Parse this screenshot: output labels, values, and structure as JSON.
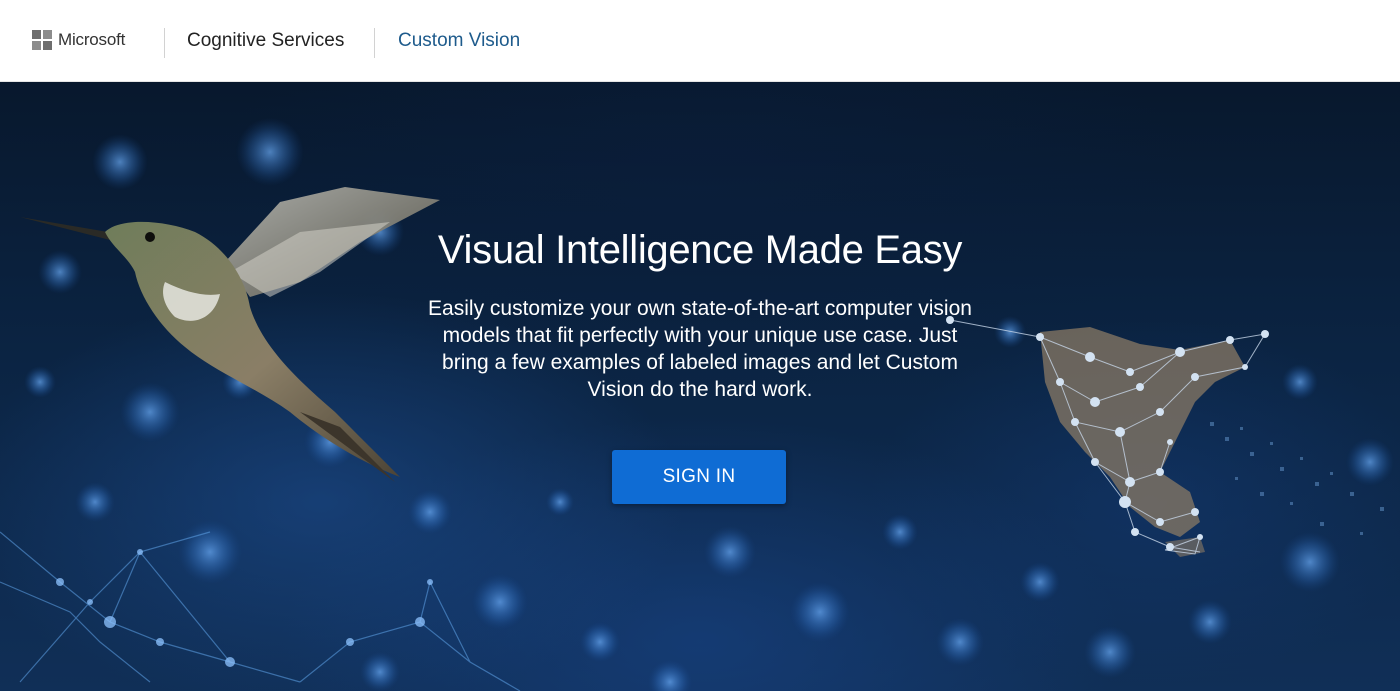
{
  "header": {
    "brand": "Microsoft",
    "logo_colors": [
      "#737373",
      "#737373",
      "#737373",
      "#737373"
    ],
    "nav": [
      {
        "label": "Cognitive Services",
        "color": "#222222"
      },
      {
        "label": "Custom Vision",
        "color": "#1e5b8c"
      }
    ]
  },
  "hero": {
    "title": "Visual Intelligence Made Easy",
    "description": "Easily customize your own state-of-the-art computer vision models that fit perfectly with your unique use case. Just bring a few examples of labeled images and let Custom Vision do the hard work.",
    "signin_label": "SIGN IN",
    "signin_color": "#0f6cd4",
    "imagery": [
      "hummingbird",
      "network-map"
    ]
  }
}
